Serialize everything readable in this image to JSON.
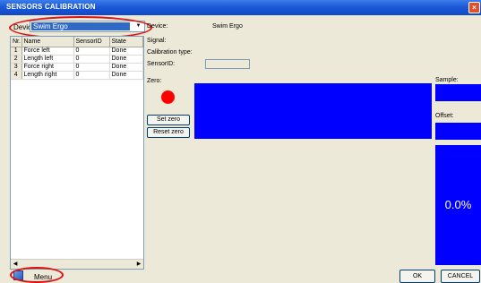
{
  "window": {
    "title": "SENSORS CALIBRATION",
    "close_glyph": "×"
  },
  "device": {
    "label": "Device:",
    "selected": "Swim Ergo",
    "arrow": "▼"
  },
  "table": {
    "headers": [
      "Nr.",
      "Name",
      "SensorID",
      "State"
    ],
    "rows": [
      {
        "nr": "1",
        "name": "Force left",
        "sensor_id": "0",
        "state": "Done"
      },
      {
        "nr": "2",
        "name": "Length left",
        "sensor_id": "0",
        "state": "Done"
      },
      {
        "nr": "3",
        "name": "Force right",
        "sensor_id": "0",
        "state": "Done"
      },
      {
        "nr": "4",
        "name": "Length right",
        "sensor_id": "0",
        "state": "Done"
      }
    ],
    "scroll_left": "◀",
    "scroll_right": "▶"
  },
  "detail": {
    "device_label": "Device:",
    "device_value": "Swim Ergo",
    "signal_label": "Signal:",
    "calibration_type_label": "Calibration type:",
    "sensor_id_label": "SensorID:",
    "zero_label": "Zero:",
    "sample_label": "Sample:",
    "offset_label": "Offset:",
    "set_zero_button": "Set zero",
    "reset_zero_button": "Reset zero",
    "percent_value": "0.0%"
  },
  "footer": {
    "menu_label": "Menu",
    "ok_button": "OK",
    "cancel_button": "CANCEL"
  },
  "colors": {
    "highlight_ellipse": "#e01010",
    "panel_blue": "#0000ff",
    "led_red": "#ff0000"
  }
}
